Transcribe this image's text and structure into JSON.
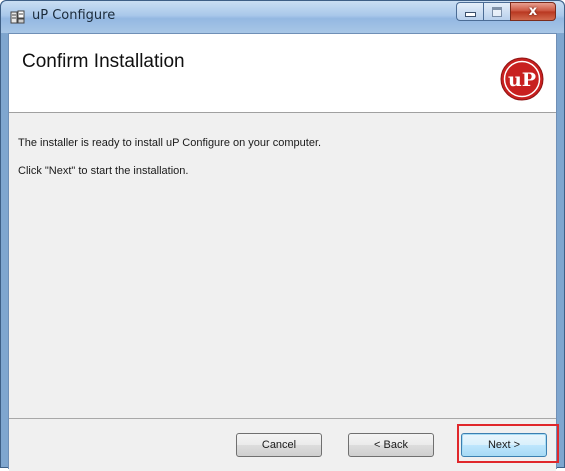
{
  "window": {
    "title": "uP Configure",
    "icon": "installer-package-icon"
  },
  "caption_buttons": {
    "minimize_icon": "minimize-icon",
    "maximize_icon": "maximize-icon",
    "close_glyph": "x"
  },
  "banner": {
    "title": "Confirm Installation",
    "logo_text": "uP"
  },
  "body": {
    "line1": "The installer is ready to install uP Configure on your computer.",
    "line2": "Click \"Next\" to start the installation."
  },
  "footer": {
    "cancel_label": "Cancel",
    "back_label": "< Back",
    "next_label": "Next >"
  },
  "colors": {
    "logo_red": "#c8201f",
    "highlight_red": "#e0272b"
  }
}
